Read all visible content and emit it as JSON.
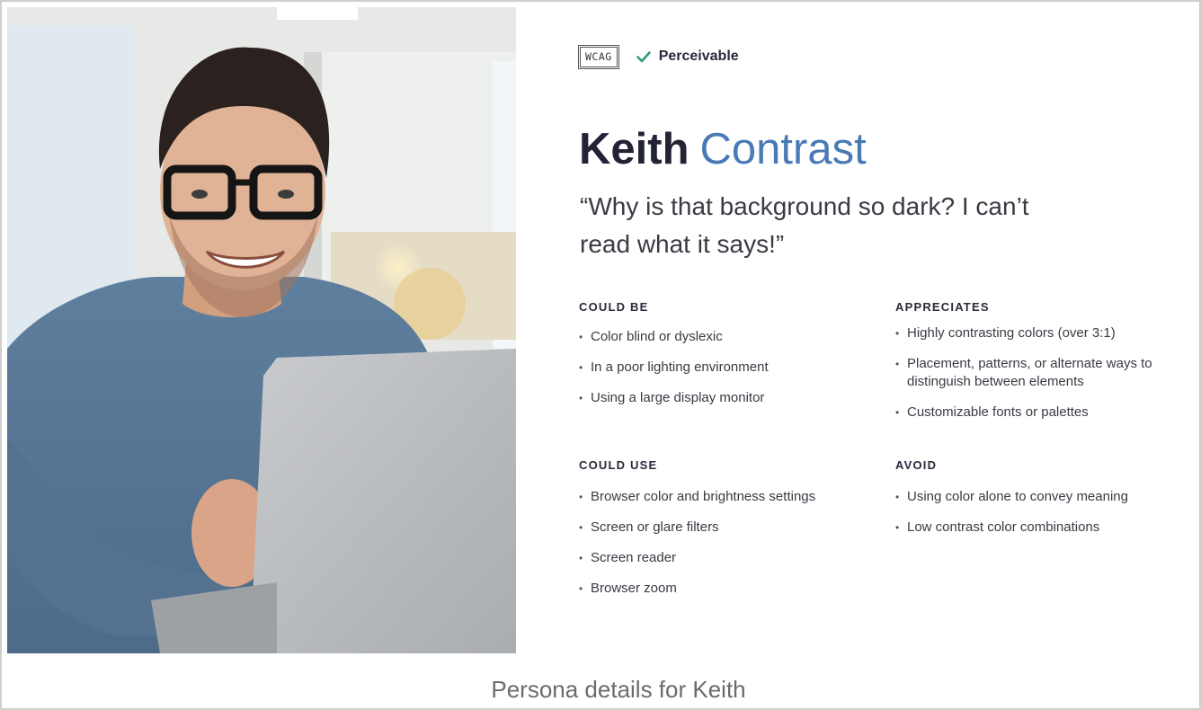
{
  "photo": {
    "alt": "Smiling man with glasses working at a laptop"
  },
  "badge": {
    "wcag": "WCAG",
    "principle": "Perceivable"
  },
  "persona": {
    "first_name": "Keith",
    "last_name": "Contrast",
    "quote": "“Why is that background so dark?  I can’t read what it says!”"
  },
  "sections": {
    "could_be": {
      "title": "COULD BE",
      "items": [
        "Color blind or dyslexic",
        "In a poor lighting environment",
        "Using a large display monitor"
      ]
    },
    "appreciates": {
      "title": "APPRECIATES",
      "items": [
        "Highly contrasting colors (over 3:1)",
        "Placement, patterns, or alternate ways to distinguish between elements",
        "Customizable fonts or palettes"
      ]
    },
    "could_use": {
      "title": "COULD USE",
      "items": [
        "Browser color and brightness settings",
        "Screen or glare filters",
        "Screen reader",
        "Browser zoom"
      ]
    },
    "avoid": {
      "title": "AVOID",
      "items": [
        "Using color alone to convey meaning",
        "Low contrast color combinations"
      ]
    }
  },
  "caption": "Persona details for Keith",
  "colors": {
    "accent": "#4a7ab5",
    "check": "#2e9e6f",
    "heading": "#232336",
    "caption": "#6b6b6b"
  }
}
